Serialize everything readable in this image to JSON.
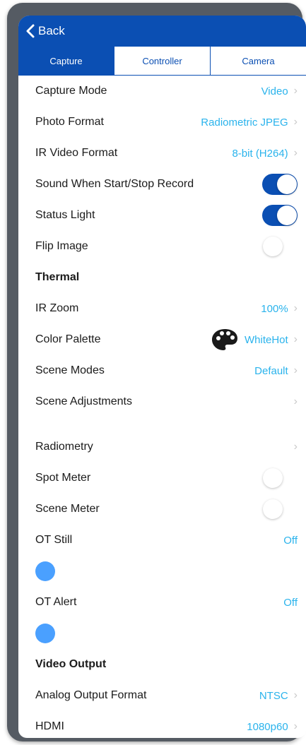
{
  "nav": {
    "back_label": "Back"
  },
  "tabs": [
    {
      "label": "Capture",
      "active": true
    },
    {
      "label": "Controller",
      "active": false
    },
    {
      "label": "Camera",
      "active": false
    }
  ],
  "rows": {
    "capture_mode": {
      "label": "Capture Mode",
      "value": "Video"
    },
    "photo_format": {
      "label": "Photo Format",
      "value": "Radiometric JPEG"
    },
    "ir_video_format": {
      "label": "IR Video Format",
      "value": "8-bit (H264)"
    },
    "sound_record": {
      "label": "Sound When Start/Stop Record",
      "on": true
    },
    "status_light": {
      "label": "Status Light",
      "on": true
    },
    "flip_image": {
      "label": "Flip Image",
      "on": false
    },
    "thermal_header": {
      "label": "Thermal"
    },
    "ir_zoom": {
      "label": "IR Zoom",
      "value": "100%"
    },
    "color_palette": {
      "label": "Color Palette",
      "value": "WhiteHot"
    },
    "scene_modes": {
      "label": "Scene Modes",
      "value": "Default"
    },
    "scene_adjustments": {
      "label": "Scene Adjustments"
    },
    "radiometry": {
      "label": "Radiometry"
    },
    "spot_meter": {
      "label": "Spot Meter",
      "on": false
    },
    "scene_meter": {
      "label": "Scene Meter",
      "on": false
    },
    "ot_still": {
      "label": "OT Still",
      "value": "Off"
    },
    "ot_alert": {
      "label": "OT Alert",
      "value": "Off"
    },
    "video_output_header": {
      "label": "Video Output"
    },
    "analog_output": {
      "label": "Analog Output Format",
      "value": "NTSC"
    },
    "hdmi": {
      "label": "HDMI",
      "value": "1080p60"
    }
  },
  "chevron": "›",
  "colors": {
    "primary": "#0b4fb3",
    "value_text": "#2ab3ec",
    "dot": "#4aa0ff"
  },
  "icons": {
    "back": "chevron-left-icon",
    "palette": "palette-icon"
  }
}
